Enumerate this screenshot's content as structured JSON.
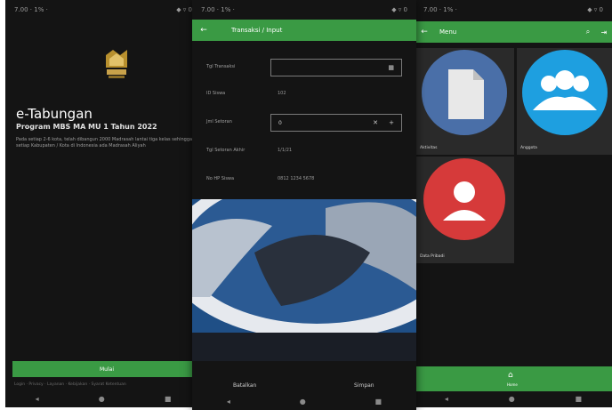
{
  "colors": {
    "brand_green": "#3a9a44",
    "dark_bg": "#141414"
  },
  "screen1": {
    "status_left": "7.00 · 1% ·",
    "status_right": "◆ ▿ 0",
    "app_title": "e-Tabungan",
    "subtitle": "Program MBS MA MU 1 Tahun 2022",
    "description": "Pada setiap 2-6 kota, telah dibangun 2000 Madrasah lantai tiga kelas sehingga setiap Kabupaten / Kota di Indonesia ada Madrasah Aliyah",
    "button_label": "Mulai",
    "footer_links": "Login · Privacy · Layanan · Kebijakan · Syarat Ketentuan",
    "nav": [
      "◂",
      "●",
      "■"
    ]
  },
  "screen2": {
    "status_left": "7.00 · 1% ·",
    "status_right": "◆ ▿ 0",
    "toolbar_title": "Transaksi / Input",
    "back_icon": "back-arrow-icon",
    "fields": [
      {
        "label": "Tgl Transaksi",
        "value": "",
        "type": "box",
        "icon": "▦"
      },
      {
        "label": "ID Siswa",
        "value": "102",
        "type": "text"
      },
      {
        "label": "Jml Setoran",
        "value": "0",
        "type": "box",
        "icon": "✕",
        "icon2": "+"
      },
      {
        "label": "Tgl Setoran Akhir",
        "value": "1/1/21",
        "type": "text"
      },
      {
        "label": "No HP Siswa",
        "value": "0812 1234 5678",
        "type": "text"
      }
    ],
    "action_left": "Batalkan",
    "action_right": "Simpan",
    "nav": [
      "◂",
      "●",
      "■"
    ]
  },
  "screen3": {
    "status_left": "7.00 · 1% ·",
    "status_right": "◆ ▿ 0",
    "toolbar_title": "Menu",
    "tiles": [
      {
        "label": "Aktivitas"
      },
      {
        "label": "Anggota"
      },
      {
        "label": "Data Pribadi"
      }
    ],
    "bottom_nav_label": "Home",
    "nav": [
      "◂",
      "●",
      "■"
    ]
  }
}
